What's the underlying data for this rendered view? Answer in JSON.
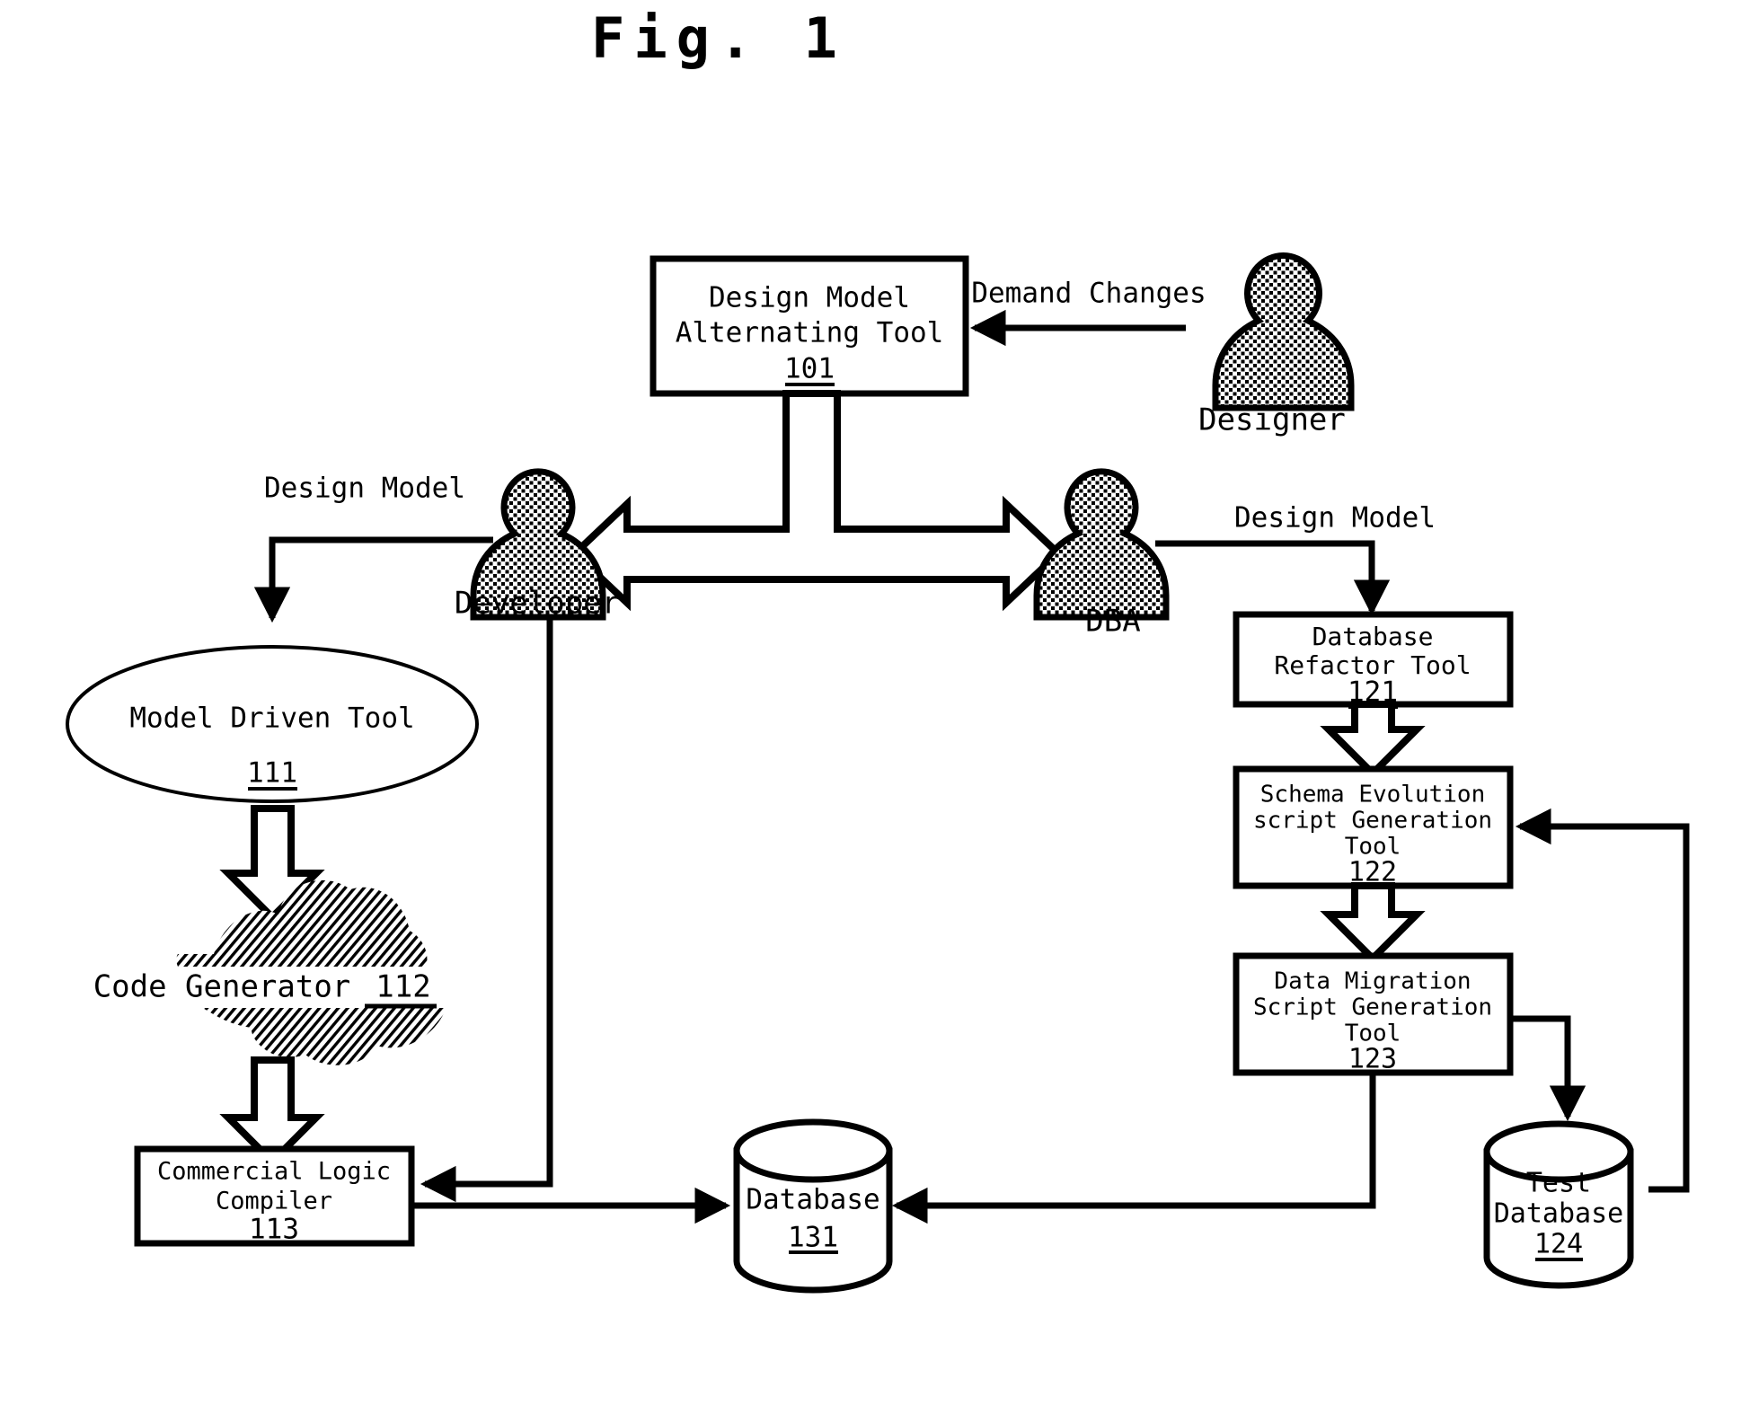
{
  "figure": {
    "title": "Fig. 1"
  },
  "nodes": {
    "design_model_alternating_tool": {
      "line1": "Design Model",
      "line2": "Alternating Tool",
      "ref": "101"
    },
    "model_driven_tool": {
      "label": "Model Driven Tool",
      "ref": "111"
    },
    "code_generator": {
      "label": "Code Generator",
      "ref": "112"
    },
    "commercial_logic_compiler": {
      "line1": "Commercial Logic",
      "line2": "Compiler",
      "ref": "113"
    },
    "database_refactor_tool": {
      "line1": "Database",
      "line2": "Refactor Tool",
      "ref": "121"
    },
    "schema_evolution_script_generation_tool": {
      "line1": "Schema Evolution",
      "line2": "script Generation",
      "line3": "Tool",
      "ref": "122"
    },
    "data_migration_script_generation_tool": {
      "line1": "Data Migration",
      "line2": "Script Generation",
      "line3": "Tool",
      "ref": "123"
    },
    "database": {
      "label": "Database",
      "ref": "131"
    },
    "test_database": {
      "line1": "Test",
      "line2": "Database",
      "ref": "124"
    }
  },
  "actors": {
    "designer": {
      "label": "Designer"
    },
    "developer": {
      "label": "Developer"
    },
    "dba": {
      "label": "DBA"
    }
  },
  "edge_labels": {
    "demand_changes": "Demand Changes",
    "design_model_left": "Design Model",
    "design_model_right": "Design Model"
  },
  "colors": {
    "stroke": "#000000",
    "fill": "#ffffff",
    "background": "#ffffff"
  }
}
